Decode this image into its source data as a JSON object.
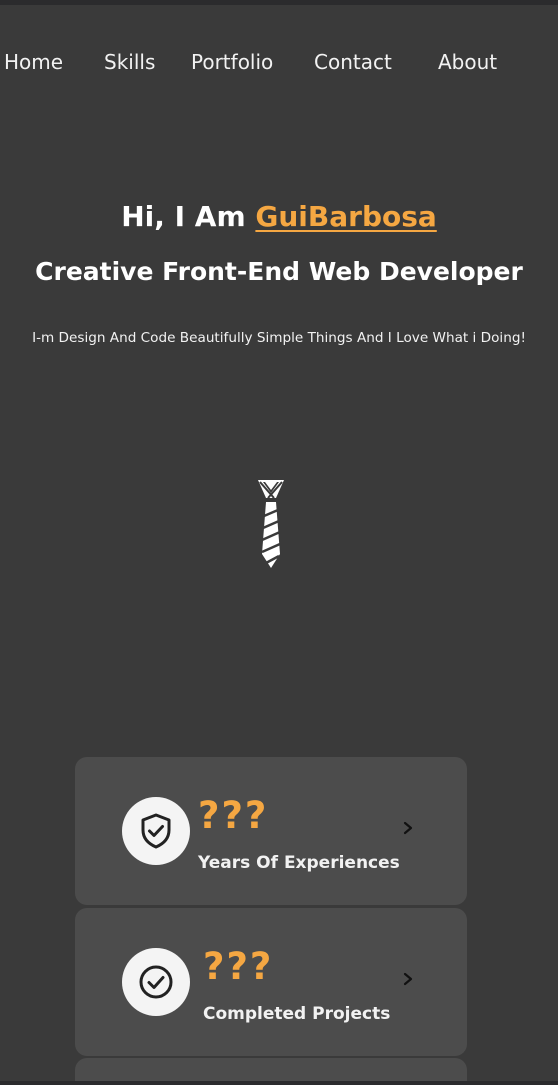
{
  "nav": {
    "items": [
      {
        "label": "Home"
      },
      {
        "label": "Skills"
      },
      {
        "label": "Portfolio"
      },
      {
        "label": "Contact"
      },
      {
        "label": "About"
      }
    ]
  },
  "hero": {
    "greeting": "Hi, I Am ",
    "name": "GuiBarbosa",
    "subtitle": "Creative Front-End Web Developer",
    "tagline": "I-m Design And Code Beautifully Simple Things And I Love What i Doing!",
    "icon": "necktie-icon"
  },
  "stats": [
    {
      "value": "???",
      "label": "Years Of Experiences",
      "icon": "shield-check-icon"
    },
    {
      "value": "???",
      "label": "Completed Projects",
      "icon": "check-circle-icon"
    }
  ],
  "colors": {
    "background": "#3a3a3a",
    "card": "#4c4c4c",
    "accent": "#f5a742",
    "text": "#ffffff"
  }
}
